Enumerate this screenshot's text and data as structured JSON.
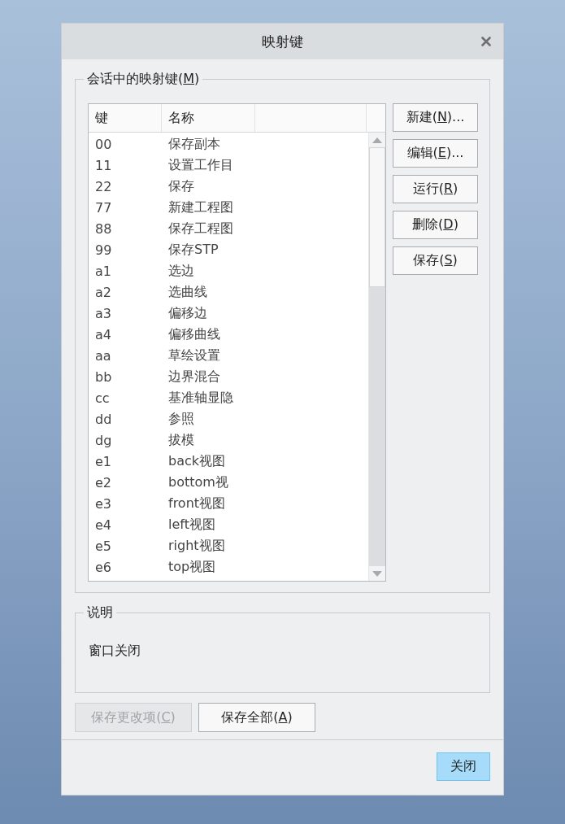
{
  "window": {
    "title": "映射键"
  },
  "mapkeys_group": {
    "label_before": "会话中的映射键(",
    "access_key": "M",
    "label_after": ")"
  },
  "table": {
    "columns": [
      "键",
      "名称"
    ],
    "rows": [
      {
        "key": "00",
        "name": "保存副本"
      },
      {
        "key": "11",
        "name": "设置工作目"
      },
      {
        "key": "22",
        "name": "保存"
      },
      {
        "key": "77",
        "name": "新建工程图"
      },
      {
        "key": "88",
        "name": "保存工程图"
      },
      {
        "key": "99",
        "name": "保存STP"
      },
      {
        "key": "a1",
        "name": "选边"
      },
      {
        "key": "a2",
        "name": "选曲线"
      },
      {
        "key": "a3",
        "name": "偏移边"
      },
      {
        "key": "a4",
        "name": "偏移曲线"
      },
      {
        "key": "aa",
        "name": "草绘设置"
      },
      {
        "key": "bb",
        "name": "边界混合"
      },
      {
        "key": "cc",
        "name": "基准轴显隐"
      },
      {
        "key": "dd",
        "name": "参照"
      },
      {
        "key": "dg",
        "name": "拔模"
      },
      {
        "key": "e1",
        "name": "back视图"
      },
      {
        "key": "e2",
        "name": "bottom视"
      },
      {
        "key": "e3",
        "name": "front视图"
      },
      {
        "key": "e4",
        "name": "left视图"
      },
      {
        "key": "e5",
        "name": "right视图"
      },
      {
        "key": "e6",
        "name": "top视图"
      }
    ]
  },
  "side_buttons": [
    {
      "label_before": "新建(",
      "access_key": "N",
      "label_after": ")..."
    },
    {
      "label_before": "编辑(",
      "access_key": "E",
      "label_after": ")..."
    },
    {
      "label_before": "运行(",
      "access_key": "R",
      "label_after": ")"
    },
    {
      "label_before": "删除(",
      "access_key": "D",
      "label_after": ")"
    },
    {
      "label_before": "保存(",
      "access_key": "S",
      "label_after": ")"
    }
  ],
  "description": {
    "label": "说明",
    "text": "窗口关闭"
  },
  "bottom_buttons": [
    {
      "label_before": "保存更改项(",
      "access_key": "C",
      "label_after": ")",
      "disabled": true
    },
    {
      "label_before": "保存全部(",
      "access_key": "A",
      "label_after": ")",
      "disabled": false
    }
  ],
  "close_button": {
    "label": "关闭",
    "focused": true
  }
}
